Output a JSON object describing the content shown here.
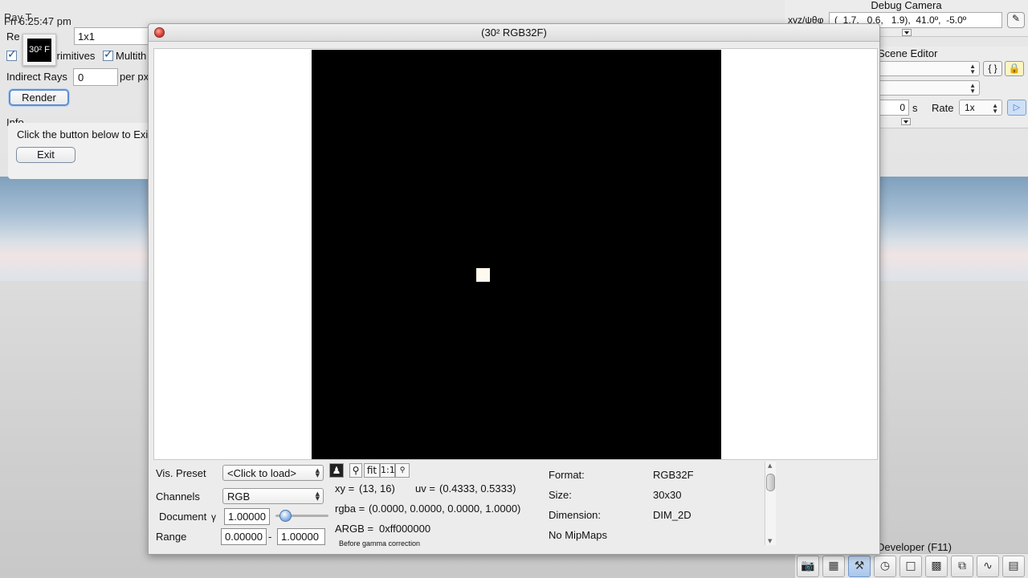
{
  "clock": "Fri 6:25:47 pm",
  "ray_panel": {
    "title": "Ray T",
    "resolution_label": "Re",
    "resolution_value": "1x1",
    "primitives_label": "Primitives",
    "multithread_label": "Multith",
    "indirect_rays_label": "Indirect Rays",
    "indirect_rays_value": "0",
    "per_px_label": "per px",
    "render_button": "Render",
    "info_label": "Info",
    "info_text": "Click the button below to Exit",
    "exit_button": "Exit",
    "thumbnail_label": "30² F"
  },
  "debug_camera": {
    "title": "Debug Camera",
    "label": "xyz/ψθφ",
    "value": "(  1.7,   0.6,   1.9),  41.0º,  -5.0º"
  },
  "scene_editor": {
    "title": "Scene Editor",
    "time_value": "0",
    "time_unit": "s",
    "rate_label": "Rate",
    "rate_value": "1x"
  },
  "developer": {
    "label": "Developer (F11)",
    "icons": [
      "camera-icon",
      "clapper-icon",
      "tools-icon",
      "clock-icon",
      "note-icon",
      "terminal-icon",
      "windows-icon",
      "monitor-icon",
      "document-icon"
    ]
  },
  "texture_window": {
    "title": "(30² RGB32F)",
    "vis_preset_label": "Vis. Preset",
    "vis_preset_value": "<Click to load>",
    "channels_label": "Channels",
    "channels_value": "RGB",
    "document_label": "Document",
    "gamma_symbol": "γ",
    "gamma_value": "1.00000",
    "range_label": "Range",
    "range_min": "0.00000",
    "range_sep": "-",
    "range_max": "1.00000",
    "tool_fit": "fit",
    "tool_one": "1:1",
    "xy_label": "xy =",
    "xy_value": "(13, 16)",
    "uv_label": "uv =",
    "uv_value": "(0.4333, 0.5333)",
    "rgba_label": "rgba =",
    "rgba_value": "(0.0000, 0.0000, 0.0000, 1.0000)",
    "argb_label": "ARGB =",
    "argb_value": "0xff000000",
    "gamma_note": "Before gamma correction",
    "format_label": "Format:",
    "format_value": "RGB32F",
    "size_label": "Size:",
    "size_value": "30x30",
    "dimension_label": "Dimension:",
    "dimension_value": "DIM_2D",
    "mipmaps_text": "No MipMaps"
  }
}
